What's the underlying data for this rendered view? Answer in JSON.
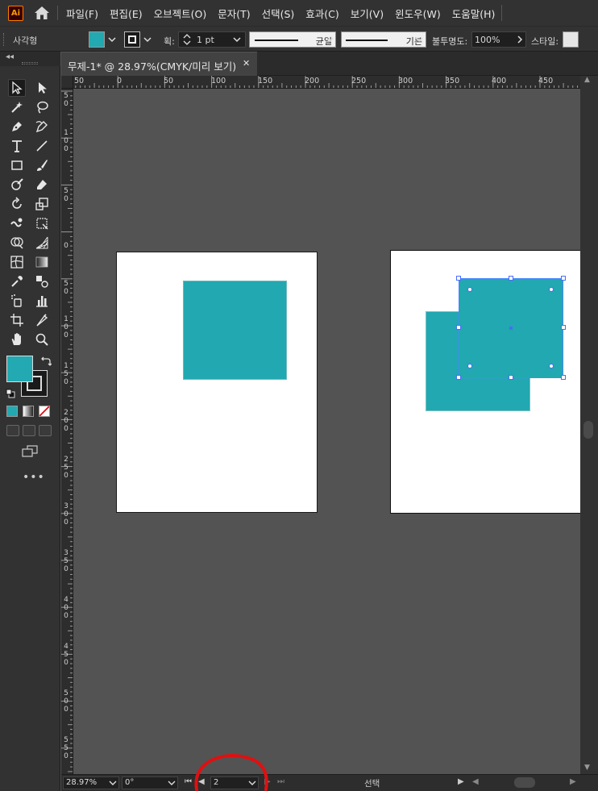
{
  "app": {
    "logo_text": "Ai"
  },
  "menu": [
    "파일(F)",
    "편집(E)",
    "오브젝트(O)",
    "문자(T)",
    "선택(S)",
    "효과(C)",
    "보기(V)",
    "윈도우(W)",
    "도움말(H)"
  ],
  "control_bar": {
    "selection_label": "사각형",
    "fill_color": "#22a9b2",
    "stroke_label": "획:",
    "stroke_weight": "1 pt",
    "profile_label": "균일",
    "brush_label": "기본",
    "opacity_label": "불투명도:",
    "opacity_value": "100%",
    "style_label": "스타일:"
  },
  "document": {
    "tab_title": "무제-1* @ 28.97%(CMYK/미리 보기)"
  },
  "ruler_h_labels": [
    "50",
    "0",
    "50",
    "100",
    "150",
    "200",
    "250",
    "300",
    "350",
    "400",
    "450"
  ],
  "ruler_v_labels": [
    "50",
    "100",
    "50",
    "0",
    "50",
    "100",
    "150",
    "200",
    "250",
    "300",
    "350",
    "400",
    "450",
    "500",
    "550"
  ],
  "status_bar": {
    "zoom": "28.97%",
    "rotation": "0°",
    "artboard_number": "2",
    "status_text": "선택"
  },
  "colors": {
    "object_fill": "#21a8b0",
    "selection": "#4a6cff",
    "annotation": "#e01010"
  }
}
